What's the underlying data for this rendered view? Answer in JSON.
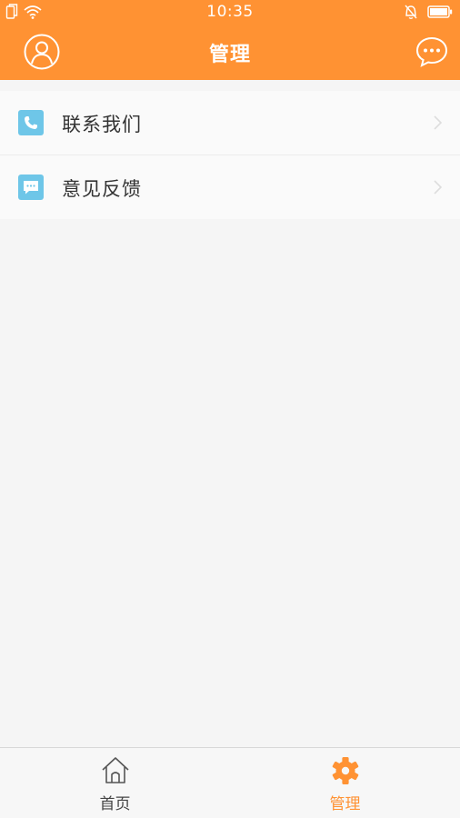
{
  "status_bar": {
    "time": "10:35",
    "icons": [
      "sim-icon",
      "wifi-icon",
      "alarm-off-icon",
      "battery-icon"
    ]
  },
  "header": {
    "title": "管理",
    "left_icon": "avatar-icon",
    "right_icon": "chat-bubble-icon"
  },
  "menu": {
    "items": [
      {
        "label": "联系我们",
        "icon": "phone-icon"
      },
      {
        "label": "意见反馈",
        "icon": "message-icon"
      }
    ]
  },
  "bottom_nav": {
    "items": [
      {
        "label": "首页",
        "icon": "home-icon",
        "active": false
      },
      {
        "label": "管理",
        "icon": "gear-icon",
        "active": true
      }
    ]
  },
  "colors": {
    "brand": "#ff9233",
    "icon_blue": "#6ec6e8",
    "background": "#f5f5f5"
  }
}
